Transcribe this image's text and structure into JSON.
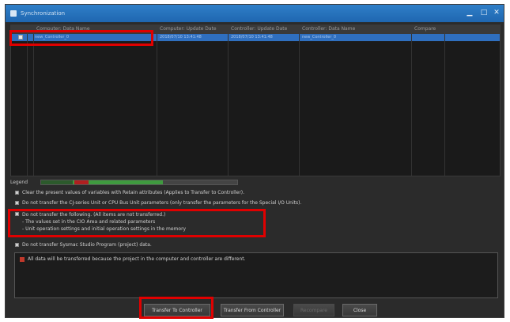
{
  "window": {
    "title": "Synchronization"
  },
  "grid": {
    "headers": [
      "Computer: Data Name",
      "Computer: Update Date",
      "Controller: Update Date",
      "Controller: Data Name",
      "Compare"
    ],
    "rows": [
      {
        "data_name": "new_Controller_0",
        "computer_date": "2018/07/10 13:41:48",
        "controller_date": "2018/07/10 13:41:48",
        "controller_name": "new_Controller_0",
        "compare": ""
      }
    ]
  },
  "progress": {
    "label": "Legend",
    "fraction": 0.62
  },
  "options": [
    {
      "text": "Clear the present values of variables with Retain attributes (Applies to Transfer to Controller)."
    },
    {
      "text": "Do not transfer the CJ-series Unit or CPU Bus Unit parameters (only transfer the parameters for the Special I/O Units)."
    },
    {
      "text": "Do not transfer the following. (All items are not transferred.)\n- The values set in the CIO Area and related parameters\n- Unit operation settings and initial operation settings in the memory"
    },
    {
      "text": "Do not transfer Sysmac Studio Program (project) data."
    }
  ],
  "message": {
    "text": "All data will be transferred because the project in the computer and controller are different."
  },
  "buttons": {
    "transfer_to_controller": "Transfer To Controller",
    "transfer_from_controller": "Transfer From Controller",
    "recompare": "Recompare",
    "close": "Close"
  },
  "colors": {
    "accent": "#2f6fbf",
    "highlight": "#e00000"
  }
}
